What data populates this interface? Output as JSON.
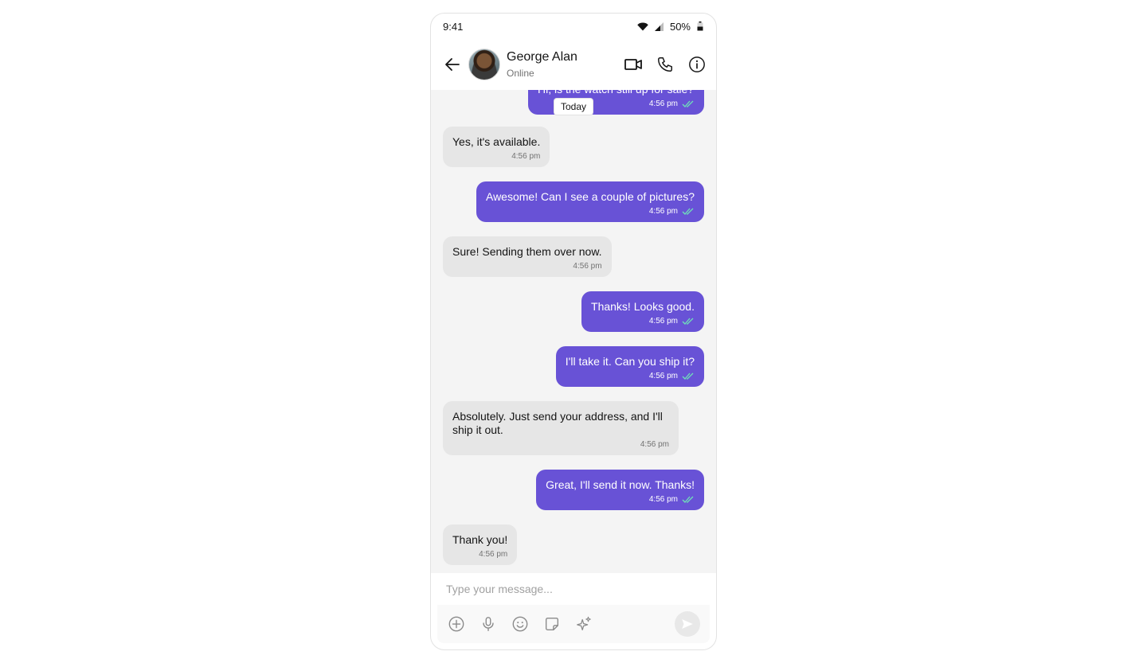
{
  "status_bar": {
    "time": "9:41",
    "battery": "50%"
  },
  "header": {
    "name": "George Alan",
    "status": "Online"
  },
  "date_chip": "Today",
  "messages": [
    {
      "dir": "out",
      "text": "Hi, is the watch still up for sale?",
      "time": "4:56 pm"
    },
    {
      "dir": "in",
      "text": "Yes, it's available.",
      "time": "4:56 pm"
    },
    {
      "dir": "out",
      "text": "Awesome! Can I see a couple of pictures?",
      "time": "4:56 pm"
    },
    {
      "dir": "in",
      "text": "Sure! Sending them over now.",
      "time": "4:56 pm"
    },
    {
      "dir": "out",
      "text": "Thanks! Looks good.",
      "time": "4:56 pm"
    },
    {
      "dir": "out",
      "text": "I'll take it. Can you ship it?",
      "time": "4:56 pm"
    },
    {
      "dir": "in",
      "text": "Absolutely. Just send your address, and I'll ship it out.",
      "time": "4:56 pm"
    },
    {
      "dir": "out",
      "text": "Great, I'll send it now. Thanks!",
      "time": "4:56 pm"
    },
    {
      "dir": "in",
      "text": "Thank you!",
      "time": "4:56 pm"
    }
  ],
  "composer": {
    "placeholder": "Type your message..."
  },
  "colors": {
    "accent": "#6852d6",
    "incoming_bubble": "#e6e6e6",
    "read_tick": "#6fe1b8",
    "background": "#f4f4f4"
  }
}
